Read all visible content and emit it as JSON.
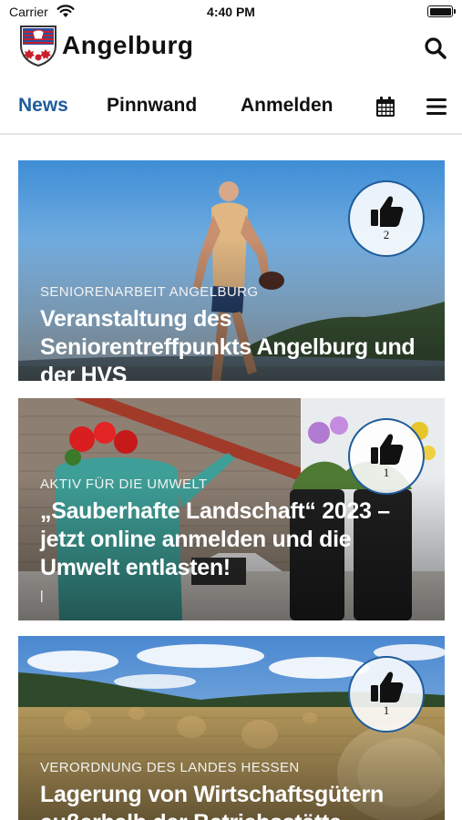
{
  "status_bar": {
    "carrier": "Carrier",
    "time": "4:40 PM"
  },
  "header": {
    "title": "Angelburg"
  },
  "tabs": [
    {
      "label": "News",
      "active": true
    },
    {
      "label": "Pinnwand",
      "active": false
    },
    {
      "label": "Anmelden",
      "active": false
    }
  ],
  "colors": {
    "accent": "#1f5c9b",
    "divider": "#e4e4e4"
  },
  "icons": [
    "wifi-icon",
    "battery-icon",
    "crest-logo",
    "search-icon",
    "calendar-icon",
    "hamburger-menu-icon",
    "thumbs-up-icon"
  ],
  "cards": [
    {
      "category": "Seniorenarbeit Angelburg",
      "title": "Veranstaltung des Seniorentreffpunkts Angelburg und der HVS",
      "likes": "2"
    },
    {
      "category": "Aktiv für die Umwelt",
      "title": "„Sauberhafte Landschaft“ 2023 – jetzt online anmelden und die Umwelt entlasten!",
      "extra": "|",
      "likes": "1"
    },
    {
      "category": "Verordnung des Landes Hessen",
      "title": "Lagerung von Wirtschaftsgütern außerhalb der Betriebsstätte",
      "likes": "1"
    }
  ]
}
